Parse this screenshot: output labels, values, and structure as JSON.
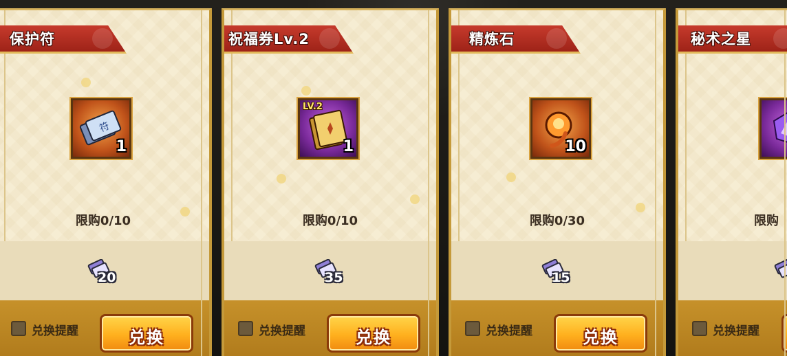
{
  "cards": [
    {
      "name": "保护符",
      "item_icon": "protection-charm-icon",
      "frame_color": "#c0531a",
      "count": "1",
      "limit": "限购0/10",
      "cost": "20",
      "remind_label": "兑换提醒",
      "button_label": "兑换"
    },
    {
      "name": "祝福券Lv.2",
      "item_icon": "blessing-ticket-icon",
      "frame_color": "#7a2a9a",
      "level_tag": "LV.2",
      "count": "1",
      "limit": "限购0/10",
      "cost": "35",
      "remind_label": "兑换提醒",
      "button_label": "兑换"
    },
    {
      "name": "精炼石",
      "item_icon": "refining-stone-icon",
      "frame_color": "#c0531a",
      "count": "10",
      "limit": "限购0/30",
      "cost": "15",
      "remind_label": "兑换提醒",
      "button_label": "兑换"
    },
    {
      "name": "秘术之星",
      "item_icon": "secret-star-icon",
      "frame_color": "#7a2a9a",
      "count": "",
      "limit": "限购",
      "cost": "",
      "remind_label": "兑换提醒",
      "button_label": "兑"
    }
  ],
  "cost_currency_icon": "exchange-ticket-icon",
  "colors": {
    "banner_red": "#c63a2c",
    "button_gold": "#ffb01e",
    "card_bg": "#f6edd3",
    "footer_gold": "#c6912a"
  }
}
